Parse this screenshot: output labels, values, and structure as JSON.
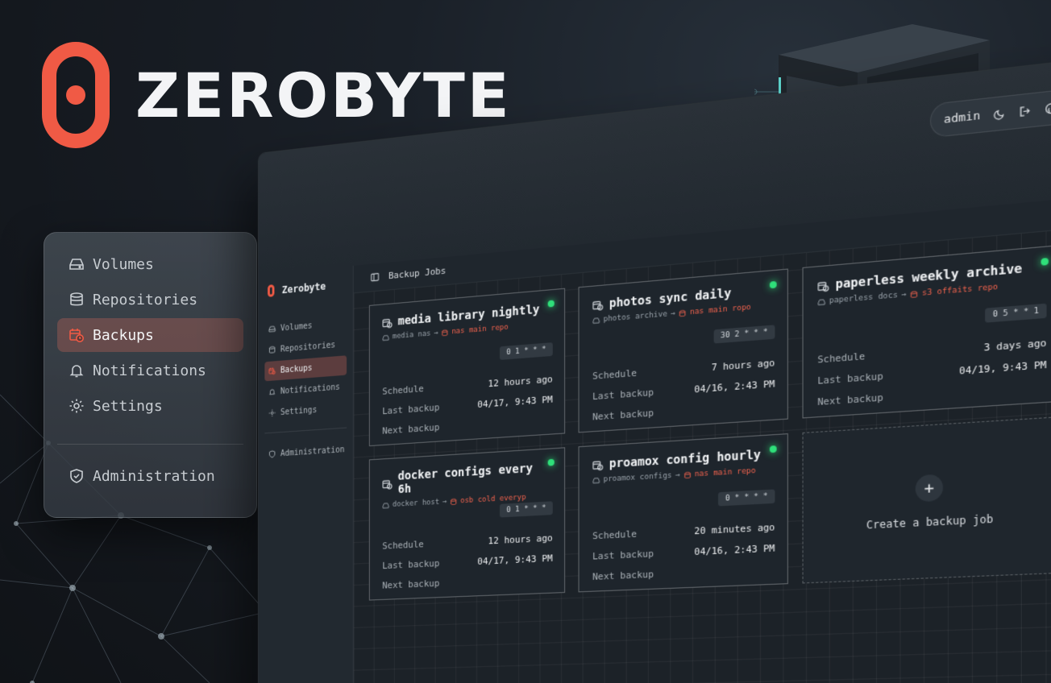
{
  "brand": {
    "name": "ZEROBYTE"
  },
  "floating_nav": {
    "items": [
      {
        "label": "Volumes",
        "icon": "hard-drive-icon"
      },
      {
        "label": "Repositories",
        "icon": "database-icon"
      },
      {
        "label": "Backups",
        "icon": "calendar-clock-icon",
        "active": true
      },
      {
        "label": "Notifications",
        "icon": "bell-icon"
      },
      {
        "label": "Settings",
        "icon": "gear-icon"
      }
    ],
    "admin_label": "Administration"
  },
  "app": {
    "brand": "Zerobyte",
    "user": "admin",
    "sidebar": {
      "items": [
        {
          "label": "Volumes",
          "icon": "hard-drive-icon"
        },
        {
          "label": "Repositories",
          "icon": "database-icon"
        },
        {
          "label": "Backups",
          "icon": "calendar-clock-icon",
          "active": true
        },
        {
          "label": "Notifications",
          "icon": "bell-icon"
        },
        {
          "label": "Settings",
          "icon": "gear-icon"
        }
      ],
      "admin_label": "Administration"
    },
    "page_title": "Backup Jobs",
    "labels": {
      "schedule": "Schedule",
      "last_backup": "Last backup",
      "next_backup": "Next backup"
    },
    "jobs": [
      {
        "name": "media library nightly",
        "source": "media nas",
        "repo": "nas main repo",
        "cron": "0 1 * * *",
        "schedule": "12 hours ago",
        "last_backup": "04/17, 9:43 PM",
        "status": "active"
      },
      {
        "name": "photos sync daily",
        "source": "photos archive",
        "repo": "nas main ropo",
        "cron": "30 2 * * *",
        "schedule": "7 hours ago",
        "last_backup": "04/16, 2:43 PM",
        "status": "active"
      },
      {
        "name": "paperless weekly archive",
        "source": "paperless docs",
        "repo": "s3 offaits repo",
        "cron": "0 5 * * 1",
        "schedule": "3 days ago",
        "last_backup": "04/19, 9:43 PM",
        "status": "active"
      },
      {
        "name": "docker configs every 6h",
        "source": "docker host",
        "repo": "osb cold everyp",
        "cron": "0 1 * * *",
        "schedule": "12 hours ago",
        "last_backup": "04/17, 9:43 PM",
        "status": "active"
      },
      {
        "name": "proamox config hourly",
        "source": "proamox configs",
        "repo": "nas main repo",
        "cron": "0 * * * *",
        "schedule": "20 minutes ago",
        "last_backup": "04/16, 2:43 PM",
        "status": "active"
      }
    ],
    "create_label": "Create a backup job"
  },
  "colors": {
    "accent": "#f05a45",
    "status_green": "#2fe07a",
    "background": "#161b21"
  }
}
